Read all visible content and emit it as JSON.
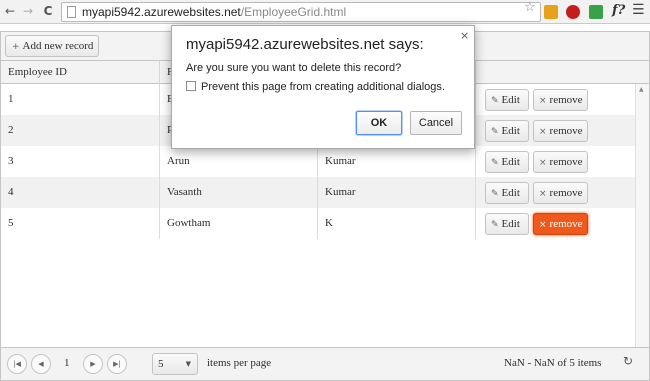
{
  "browser": {
    "url_host": "myapi5942.azurewebsites.net",
    "url_path": "/EmployeeGrid.html",
    "back_icon": "←",
    "forward_icon": "→",
    "reload_icon": "C",
    "star_icon": "☆",
    "ext_fn_label": "f?",
    "menu_icon": "☰"
  },
  "toolbar": {
    "add_label": "Add new record",
    "add_icon": "+"
  },
  "grid": {
    "columns": [
      "Employee ID",
      "F",
      "",
      ""
    ],
    "rows": [
      {
        "id": "1",
        "first": "E",
        "last": "",
        "edit": "Edit",
        "remove": "remove"
      },
      {
        "id": "2",
        "first": "P",
        "last": "",
        "edit": "Edit",
        "remove": "remove"
      },
      {
        "id": "3",
        "first": "Arun",
        "last": "Kumar",
        "edit": "Edit",
        "remove": "remove"
      },
      {
        "id": "4",
        "first": "Vasanth",
        "last": "Kumar",
        "edit": "Edit",
        "remove": "remove"
      },
      {
        "id": "5",
        "first": "Gowtham",
        "last": "K",
        "edit": "Edit",
        "remove": "remove"
      }
    ],
    "edit_icon": "✎",
    "remove_icon": "×",
    "active_remove_color": "#ef5a1c"
  },
  "pager": {
    "current_page": "1",
    "page_size": "5",
    "items_per_page_label": "items per page",
    "info": "NaN - NaN of 5 items",
    "first_icon": "|◀",
    "prev_icon": "◀",
    "next_icon": "▶",
    "last_icon": "▶|",
    "refresh_icon": "↻"
  },
  "dialog": {
    "title": "myapi5942.azurewebsites.net says:",
    "message": "Are you sure you want to delete this record?",
    "checkbox_label": "Prevent this page from creating additional dialogs.",
    "checkbox_checked": false,
    "ok_label": "OK",
    "cancel_label": "Cancel",
    "close_icon": "×"
  }
}
